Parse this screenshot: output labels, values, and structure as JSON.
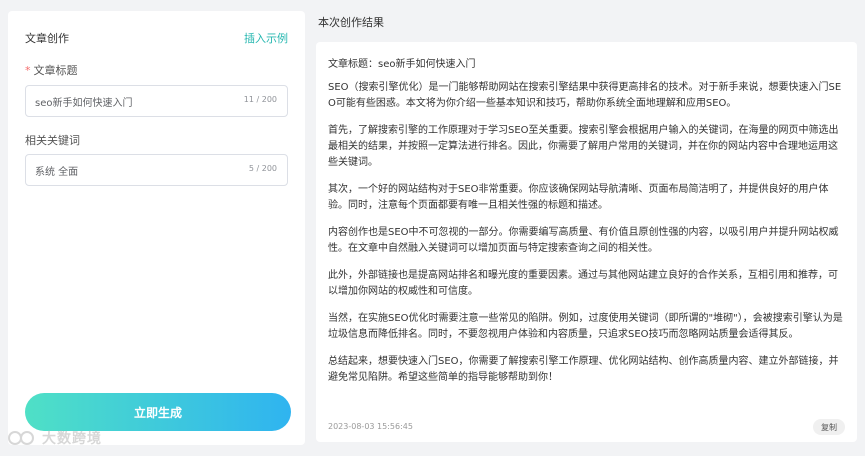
{
  "form": {
    "title": "文章创作",
    "insert_example": "插入示例",
    "title_field": {
      "required_mark": "*",
      "label": "文章标题",
      "value": "seo新手如何快速入门",
      "count": "11 / 200"
    },
    "keywords_field": {
      "label": "相关关键词",
      "value": "系统 全面",
      "count": "5 / 200"
    },
    "generate_label": "立即生成"
  },
  "watermark": {
    "text": "大数跨境"
  },
  "result": {
    "header": "本次创作结果",
    "article_title": "文章标题：seo新手如何快速入门",
    "paragraphs": [
      "SEO（搜索引擎优化）是一门能够帮助网站在搜索引擎结果中获得更高排名的技术。对于新手来说，想要快速入门SEO可能有些困惑。本文将为你介绍一些基本知识和技巧，帮助你系统全面地理解和应用SEO。",
      "首先，了解搜索引擎的工作原理对于学习SEO至关重要。搜索引擎会根据用户输入的关键词，在海量的网页中筛选出最相关的结果，并按照一定算法进行排名。因此，你需要了解用户常用的关键词，并在你的网站内容中合理地运用这些关键词。",
      "其次，一个好的网站结构对于SEO非常重要。你应该确保网站导航清晰、页面布局简洁明了，并提供良好的用户体验。同时，注意每个页面都要有唯一且相关性强的标题和描述。",
      "内容创作也是SEO中不可忽视的一部分。你需要编写高质量、有价值且原创性强的内容，以吸引用户并提升网站权威性。在文章中自然融入关键词可以增加页面与特定搜索查询之间的相关性。",
      "此外，外部链接也是提高网站排名和曝光度的重要因素。通过与其他网站建立良好的合作关系，互相引用和推荐，可以增加你网站的权威性和可信度。",
      "当然，在实施SEO优化时需要注意一些常见的陷阱。例如，过度使用关键词（即所谓的\"堆砌\"），会被搜索引擎认为是垃圾信息而降低排名。同时，不要忽视用户体验和内容质量，只追求SEO技巧而忽略网站质量会适得其反。",
      "总结起来，想要快速入门SEO，你需要了解搜索引擎工作原理、优化网站结构、创作高质量内容、建立外部链接，并避免常见陷阱。希望这些简单的指导能够帮助到你！"
    ],
    "timestamp": "2023-08-03 15:56:45",
    "copy_label": "复制"
  }
}
